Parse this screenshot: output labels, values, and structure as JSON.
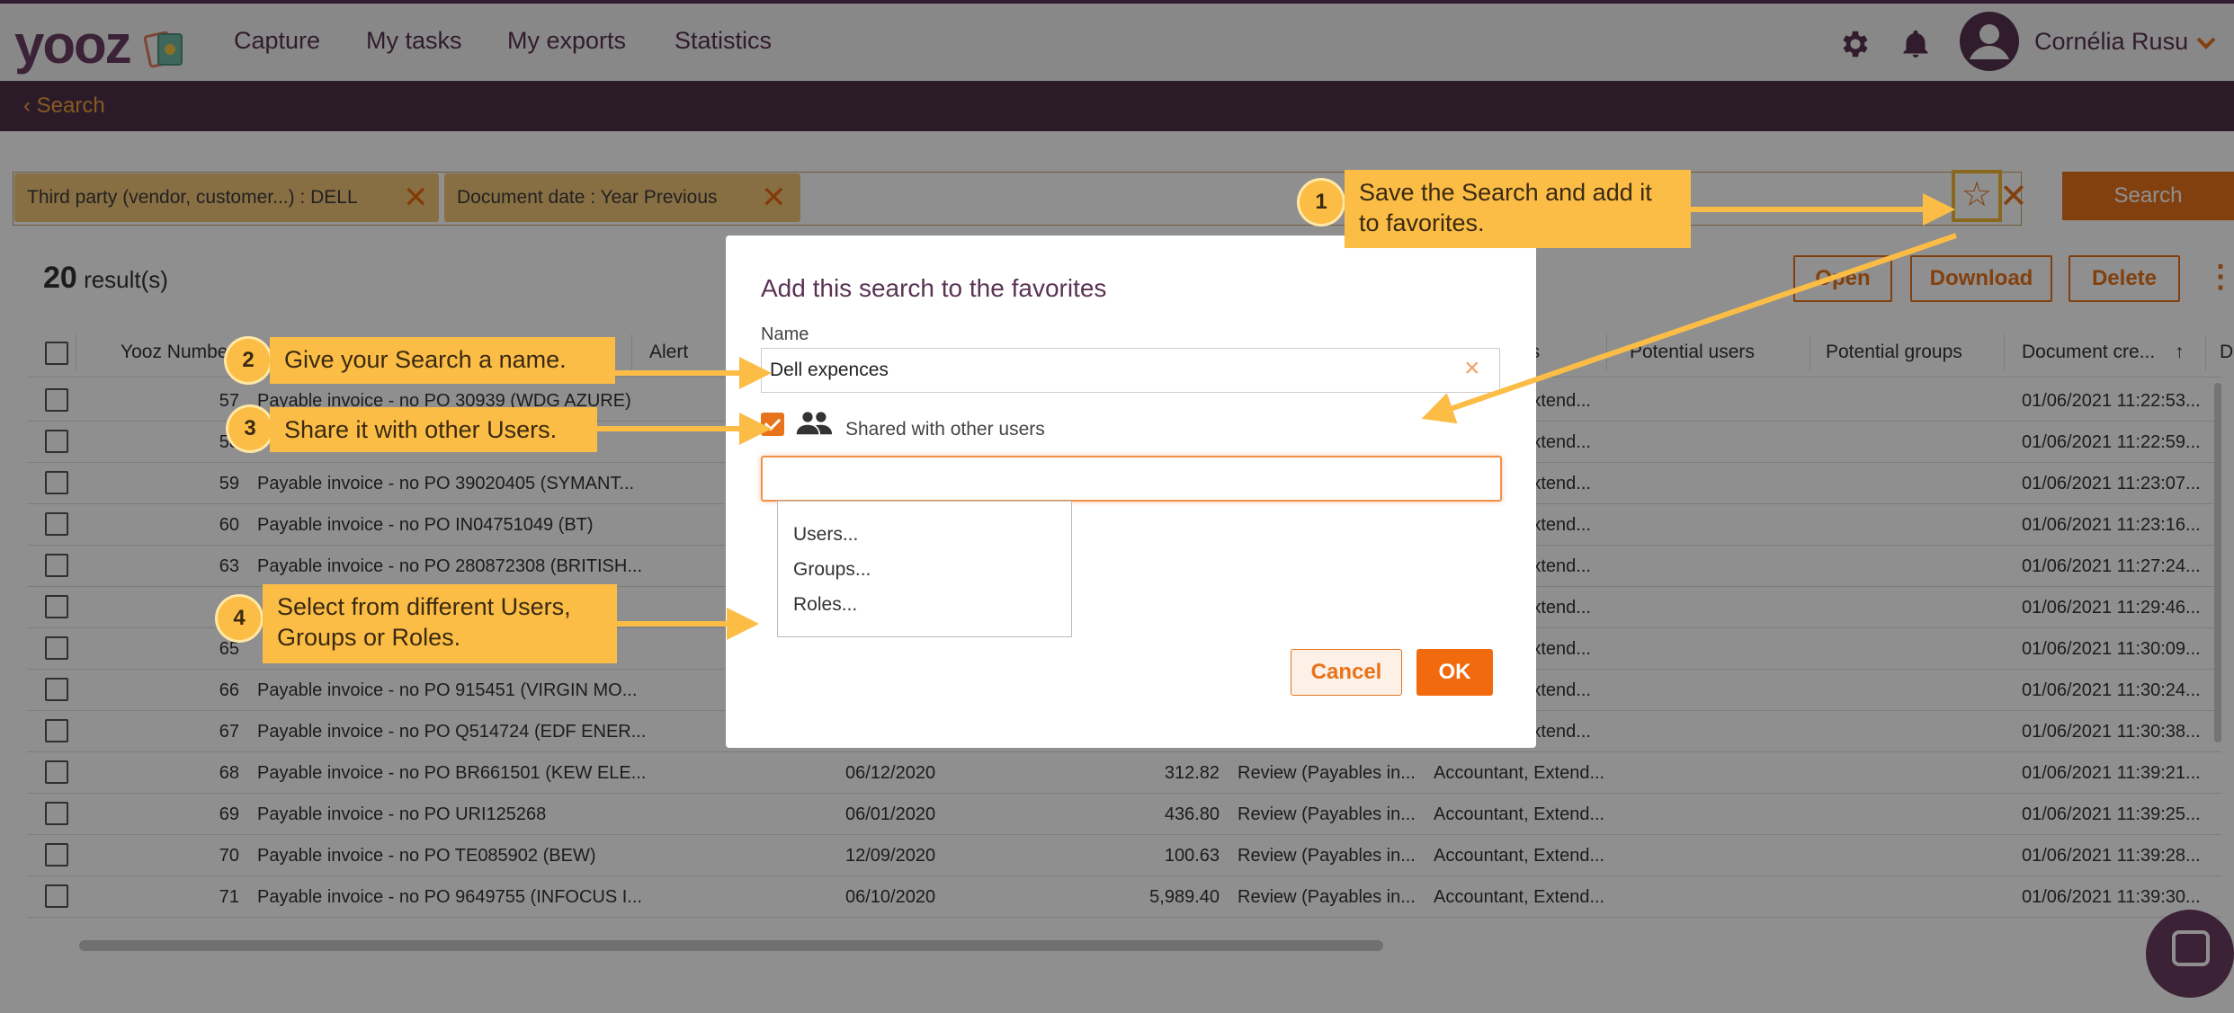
{
  "app": {
    "logo": "yooz",
    "nav": [
      "Capture",
      "My tasks",
      "My exports",
      "Statistics"
    ],
    "user_name": "Cornélia Rusu",
    "icons": [
      "gear-icon",
      "bell-icon",
      "avatar-icon",
      "chevron-down-icon"
    ]
  },
  "subnav": {
    "back_label": "Search"
  },
  "filters": {
    "chips": [
      "Third party (vendor, customer...) : DELL",
      "Document date : Year Previous"
    ],
    "search_button": "Search"
  },
  "results": {
    "count": "20",
    "label": "result(s)",
    "actions": [
      "Open",
      "Download",
      "Delete"
    ]
  },
  "table": {
    "headers": [
      "Yooz Number",
      "Alert",
      "es",
      "Potential users",
      "Potential groups",
      "Document cre...",
      "D"
    ],
    "rows": [
      {
        "num": "57",
        "title": "Payable invoice - no PO 30939 (WDG AZURE)",
        "date": "",
        "amount": "",
        "status": "",
        "roles": "Extend...",
        "created": "01/06/2021 11:22:53..."
      },
      {
        "num": "58",
        "title": "",
        "date": "",
        "amount": "",
        "status": "",
        "roles": "Extend...",
        "created": "01/06/2021 11:22:59..."
      },
      {
        "num": "59",
        "title": "Payable invoice - no PO 39020405 (SYMANT...",
        "date": "",
        "amount": "",
        "status": "",
        "roles": "Extend...",
        "created": "01/06/2021 11:23:07..."
      },
      {
        "num": "60",
        "title": "Payable invoice - no PO IN04751049 (BT)",
        "date": "",
        "amount": "",
        "status": "",
        "roles": "Extend...",
        "created": "01/06/2021 11:23:16..."
      },
      {
        "num": "63",
        "title": "Payable invoice - no PO 280872308 (BRITISH...",
        "date": "",
        "amount": "",
        "status": "",
        "roles": "Extend...",
        "created": "01/06/2021 11:27:24..."
      },
      {
        "num": "",
        "title": "",
        "date": "",
        "amount": "",
        "status": "",
        "roles": "Extend...",
        "created": "01/06/2021 11:29:46..."
      },
      {
        "num": "65",
        "title": "",
        "date": "",
        "amount": "",
        "status": "",
        "roles": "Extend...",
        "created": "01/06/2021 11:30:09..."
      },
      {
        "num": "66",
        "title": "Payable invoice - no PO 915451 (VIRGIN MO...",
        "date": "",
        "amount": "",
        "status": "",
        "roles": "Extend...",
        "created": "01/06/2021 11:30:24..."
      },
      {
        "num": "67",
        "title": "Payable invoice - no PO Q514724 (EDF ENER...",
        "date": "",
        "amount": "",
        "status": "",
        "roles": "Extend...",
        "created": "01/06/2021 11:30:38..."
      },
      {
        "num": "68",
        "title": "Payable invoice - no PO BR661501 (KEW ELE...",
        "date": "06/12/2020",
        "amount": "312.82",
        "status": "Review (Payables in...",
        "roles": "Accountant, Extend...",
        "created": "01/06/2021 11:39:21..."
      },
      {
        "num": "69",
        "title": "Payable invoice - no PO URI125268",
        "date": "06/01/2020",
        "amount": "436.80",
        "status": "Review (Payables in...",
        "roles": "Accountant, Extend...",
        "created": "01/06/2021 11:39:25..."
      },
      {
        "num": "70",
        "title": "Payable invoice - no PO TE085902 (BEW)",
        "date": "12/09/2020",
        "amount": "100.63",
        "status": "Review (Payables in...",
        "roles": "Accountant, Extend...",
        "created": "01/06/2021 11:39:28..."
      },
      {
        "num": "71",
        "title": "Payable invoice - no PO 9649755 (INFOCUS I...",
        "date": "06/10/2020",
        "amount": "5,989.40",
        "status": "Review (Payables in...",
        "roles": "Accountant, Extend...",
        "created": "01/06/2021 11:39:30..."
      }
    ]
  },
  "dialog": {
    "title": "Add this search to the favorites",
    "name_label": "Name",
    "name_value": "Dell expences",
    "share_label": "Shared with other users",
    "shared_checked": true,
    "dropdown_options": [
      "Users...",
      "Groups...",
      "Roles..."
    ],
    "cancel": "Cancel",
    "ok": "OK"
  },
  "callouts": [
    {
      "num": "1",
      "text": "Save the Search and add it to favorites."
    },
    {
      "num": "2",
      "text": "Give your Search a name."
    },
    {
      "num": "3",
      "text": "Share it with other Users."
    },
    {
      "num": "4",
      "text": "Select from different Users, Groups or Roles."
    }
  ],
  "colors": {
    "accent": "#e8731b",
    "brand": "#4e3049",
    "callout": "#fbbd45"
  }
}
